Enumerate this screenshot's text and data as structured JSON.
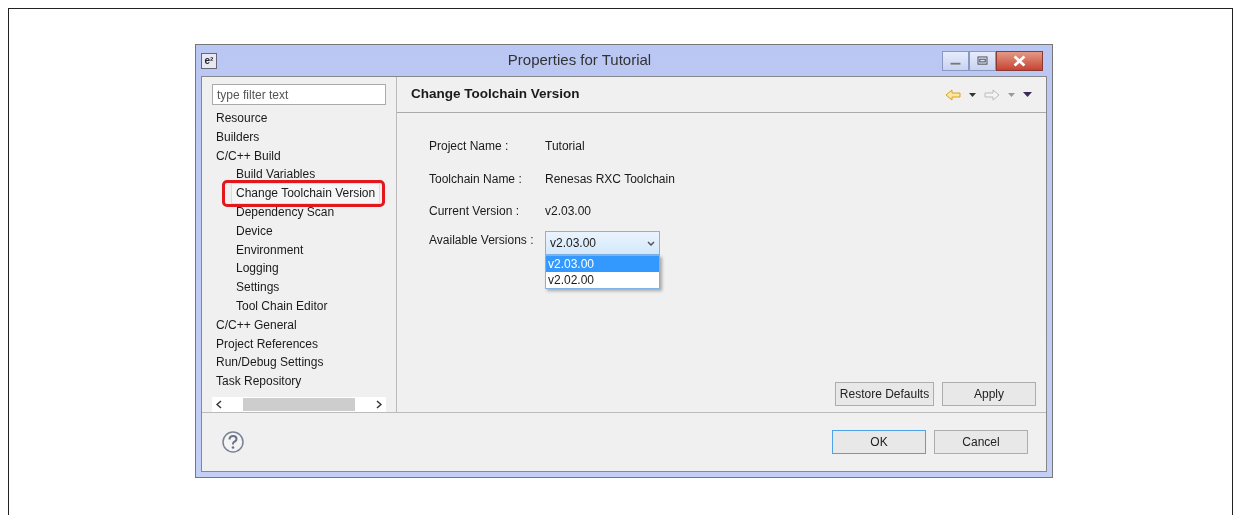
{
  "window": {
    "title": "Properties for Tutorial",
    "app_icon": "e²"
  },
  "filter": {
    "placeholder": "type filter text"
  },
  "tree": [
    {
      "label": "Resource",
      "selected": false
    },
    {
      "label": "Builders",
      "selected": false
    },
    {
      "label": "C/C++ Build",
      "selected": false,
      "children": [
        {
          "label": "Build Variables",
          "selected": false
        },
        {
          "label": "Change Toolchain Version",
          "selected": true
        },
        {
          "label": "Dependency Scan",
          "selected": false
        },
        {
          "label": "Device",
          "selected": false
        },
        {
          "label": "Environment",
          "selected": false
        },
        {
          "label": "Logging",
          "selected": false
        },
        {
          "label": "Settings",
          "selected": false
        },
        {
          "label": "Tool Chain Editor",
          "selected": false
        }
      ]
    },
    {
      "label": "C/C++ General",
      "selected": false
    },
    {
      "label": "Project References",
      "selected": false
    },
    {
      "label": "Run/Debug Settings",
      "selected": false
    },
    {
      "label": "Task Repository",
      "selected": false
    }
  ],
  "page": {
    "title": "Change Toolchain Version",
    "fields": [
      {
        "label": "Project Name :",
        "value": "Tutorial"
      },
      {
        "label": "Toolchain Name :",
        "value": "Renesas RXC Toolchain"
      },
      {
        "label": "Current Version :",
        "value": "v2.03.00"
      }
    ],
    "versions": {
      "label": "Available Versions :",
      "value": "v2.03.00",
      "expanded": true,
      "options": [
        {
          "label": "v2.03.00",
          "selected": true
        },
        {
          "label": "v2.02.00",
          "selected": false
        }
      ]
    },
    "buttons": [
      "Restore Defaults",
      "Apply"
    ]
  },
  "footer_buttons": [
    {
      "label": "OK",
      "default": true
    },
    {
      "label": "Cancel",
      "default": false
    }
  ]
}
